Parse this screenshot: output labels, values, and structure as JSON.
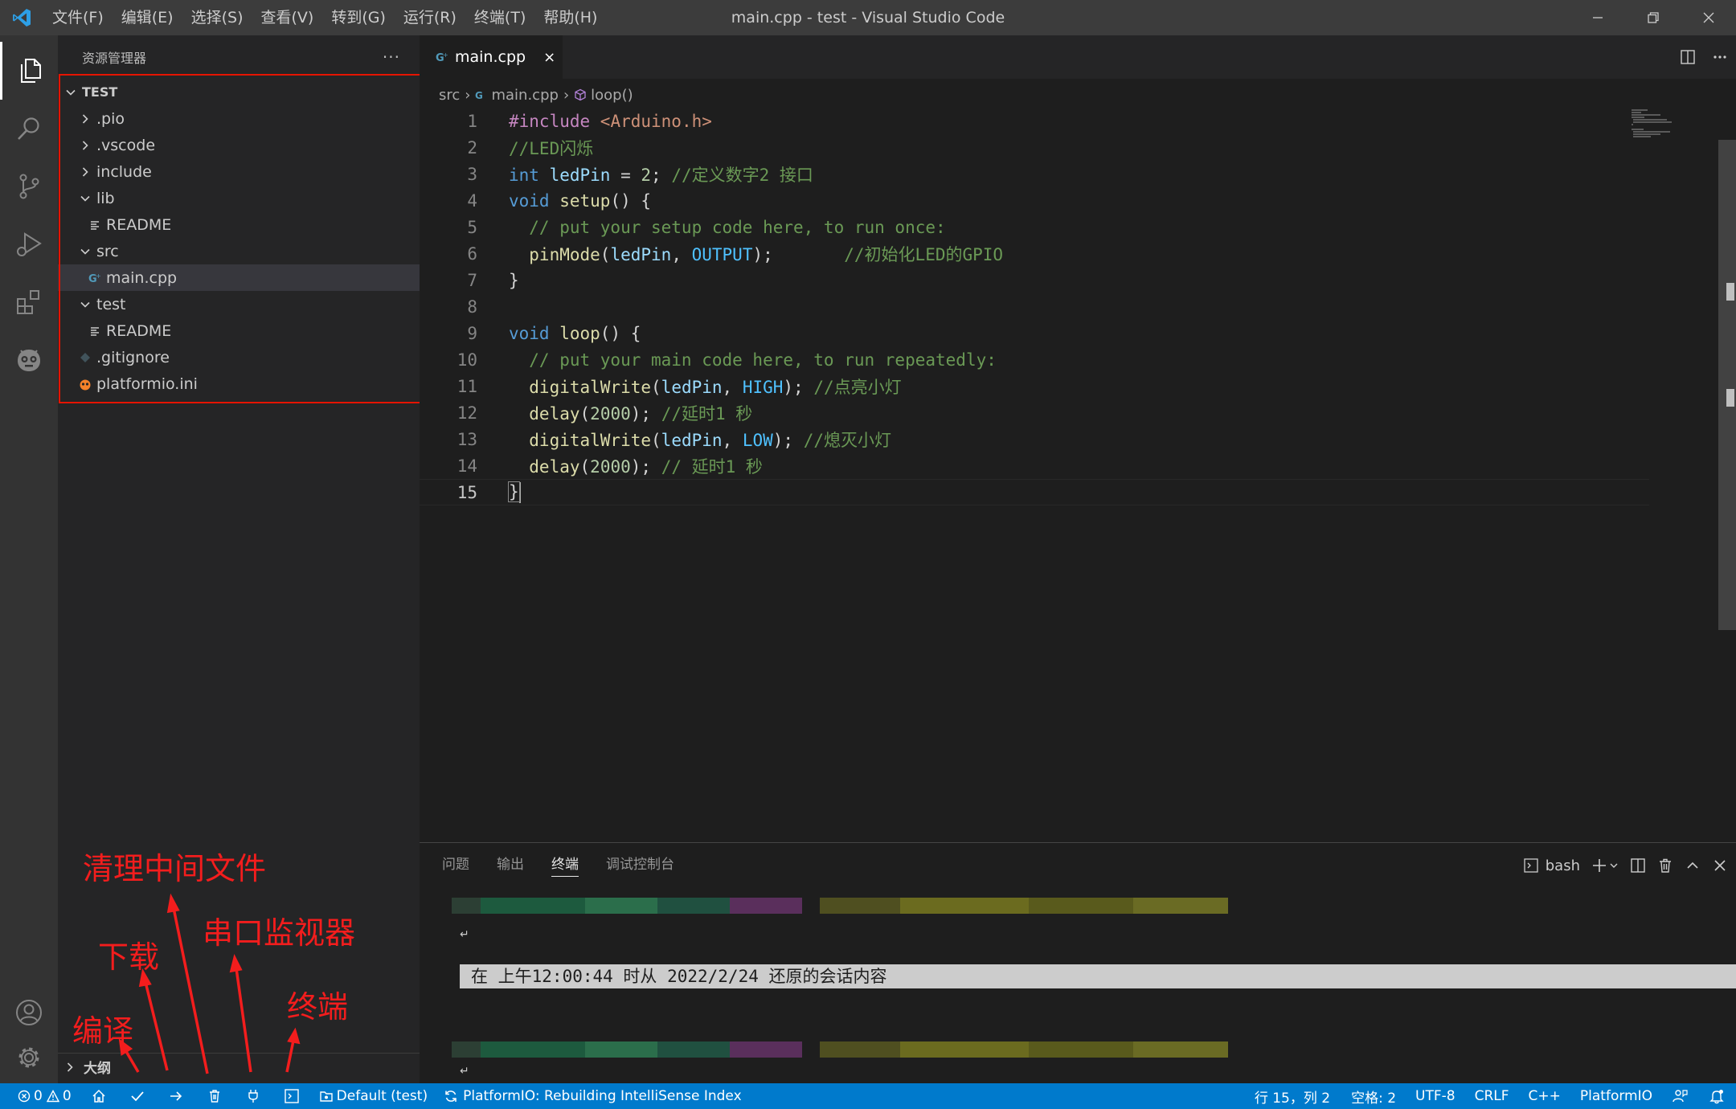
{
  "window": {
    "title": "main.cpp - test - Visual Studio Code"
  },
  "menu": [
    "文件(F)",
    "编辑(E)",
    "选择(S)",
    "查看(V)",
    "转到(G)",
    "运行(R)",
    "终端(T)",
    "帮助(H)"
  ],
  "activity": [
    "files-icon",
    "search-icon",
    "source-control-icon",
    "run-debug-icon",
    "extensions-icon",
    "platformio-icon",
    "account-icon",
    "settings-icon"
  ],
  "sidebar": {
    "title": "资源管理器",
    "more": "···",
    "root": "TEST",
    "items": [
      ".pio",
      ".vscode",
      "include",
      "lib",
      "README",
      "src",
      "main.cpp",
      "test",
      "README",
      ".gitignore",
      "platformio.ini"
    ],
    "outline": "大纲"
  },
  "annotations": {
    "clean": "清理中间文件",
    "upload": "下载",
    "monitor": "串口监视器",
    "compile": "编译",
    "terminal": "终端"
  },
  "tab": {
    "label": "main.cpp",
    "close": "×"
  },
  "breadcrumb": [
    "src",
    "main.cpp",
    "loop()"
  ],
  "code": {
    "line_numbers": [
      "1",
      "2",
      "3",
      "4",
      "5",
      "6",
      "7",
      "8",
      "9",
      "10",
      "11",
      "12",
      "13",
      "14",
      "15"
    ],
    "l1_a": "#include",
    "l1_b": " <Arduino.h>",
    "l2": "//LED闪烁",
    "l3_kw": "int",
    "l3_var": " ledPin",
    "l3_op": " = ",
    "l3_num": "2",
    "l3_semi": "; ",
    "l3_com": "//定义数字2 接口",
    "l4_kw": "void",
    "l4_fn": " setup",
    "l4_rest": "() {",
    "l5": "  // put your setup code here, to run once:",
    "l6_fn": "  pinMode",
    "l6_p": "(",
    "l6_var": "ledPin",
    "l6_c": ", ",
    "l6_cst": "OUTPUT",
    "l6_e": ");",
    "l6_com": "       //初始化LED的GPIO",
    "l7": "}",
    "l9_kw": "void",
    "l9_fn": " loop",
    "l9_rest": "() {",
    "l10": "  // put your main code here, to run repeatedly:",
    "l11_fn": "  digitalWrite",
    "l11_p": "(",
    "l11_var": "ledPin",
    "l11_c": ", ",
    "l11_cst": "HIGH",
    "l11_e": "); ",
    "l11_com": "//点亮小灯",
    "l12_fn": "  delay",
    "l12_p": "(",
    "l12_num": "2000",
    "l12_e": "); ",
    "l12_com": "//延时1 秒",
    "l13_fn": "  digitalWrite",
    "l13_p": "(",
    "l13_var": "ledPin",
    "l13_c": ", ",
    "l13_cst": "LOW",
    "l13_e": "); ",
    "l13_com": "//熄灭小灯",
    "l14_fn": "  delay",
    "l14_p": "(",
    "l14_num": "2000",
    "l14_e": "); ",
    "l14_com": "// 延时1 秒",
    "l15": "}"
  },
  "panel": {
    "tabs": [
      "问题",
      "输出",
      "终端",
      "调试控制台"
    ],
    "shell": "bash",
    "restore": "在 上午12:00:44 时从 2022/2/24 还原的会话内容",
    "prompt_mark": "↵"
  },
  "status": {
    "errors": "0",
    "warnings": "0",
    "env": "Default (test)",
    "task": "PlatformIO: Rebuilding IntelliSense Index",
    "position": "行 15，列 2",
    "spaces": "空格: 2",
    "encoding": "UTF-8",
    "eol": "CRLF",
    "language": "C++",
    "platform": "PlatformIO"
  },
  "colors": {
    "accent": "#007acc",
    "annotation": "#f31d1d",
    "titlebar": "#3c3c3c",
    "sidebar": "#252526",
    "editor": "#1e1e1e"
  }
}
